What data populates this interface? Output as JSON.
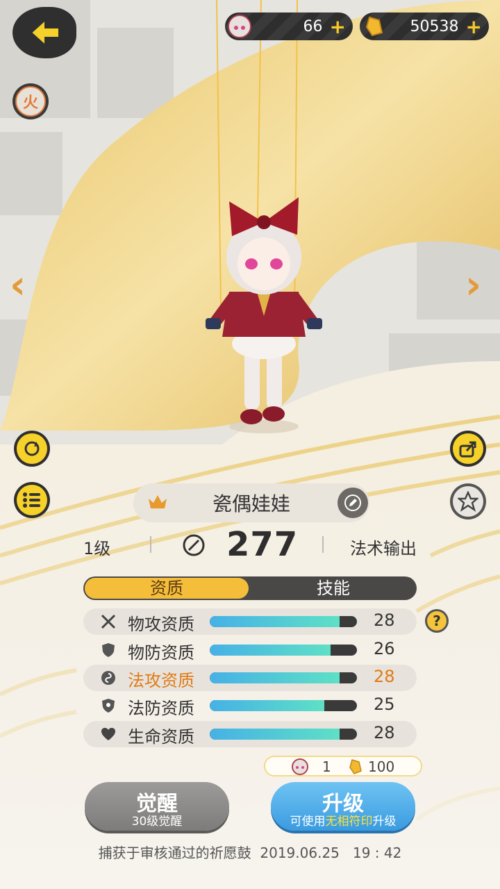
{
  "currency": {
    "gems_value": "66",
    "gold_value": "50538",
    "plus_label": "+"
  },
  "element": {
    "label": "火"
  },
  "pet": {
    "name": "瓷偶娃娃",
    "level": "1级",
    "power": "277",
    "role": "法术输出"
  },
  "tabs": [
    {
      "label": "资质",
      "active": true
    },
    {
      "label": "技能",
      "active": false
    }
  ],
  "attributes": [
    {
      "label": "物攻资质",
      "value": "28",
      "fill": 0.88,
      "icon": "crossed-swords-icon"
    },
    {
      "label": "物防资质",
      "value": "26",
      "fill": 0.82,
      "icon": "shield-icon"
    },
    {
      "label": "法攻资质",
      "value": "28",
      "fill": 0.88,
      "icon": "magic-swirl-icon",
      "highlight": true
    },
    {
      "label": "法防资质",
      "value": "25",
      "fill": 0.78,
      "icon": "magic-shield-icon"
    },
    {
      "label": "生命资质",
      "value": "28",
      "fill": 0.88,
      "icon": "heart-icon"
    }
  ],
  "help_label": "?",
  "upgrade_cost": {
    "item_count": "1",
    "gold_count": "100"
  },
  "buttons": {
    "awaken_title": "觉醒",
    "awaken_sub": "30级觉醒",
    "upgrade_title": "升级",
    "upgrade_sub_pre": "可使用",
    "upgrade_sub_highlight": "无相符印",
    "upgrade_sub_post": "升级"
  },
  "footer": "捕获于审核通过的祈愿鼓  2019.06.25   19 : 42"
}
